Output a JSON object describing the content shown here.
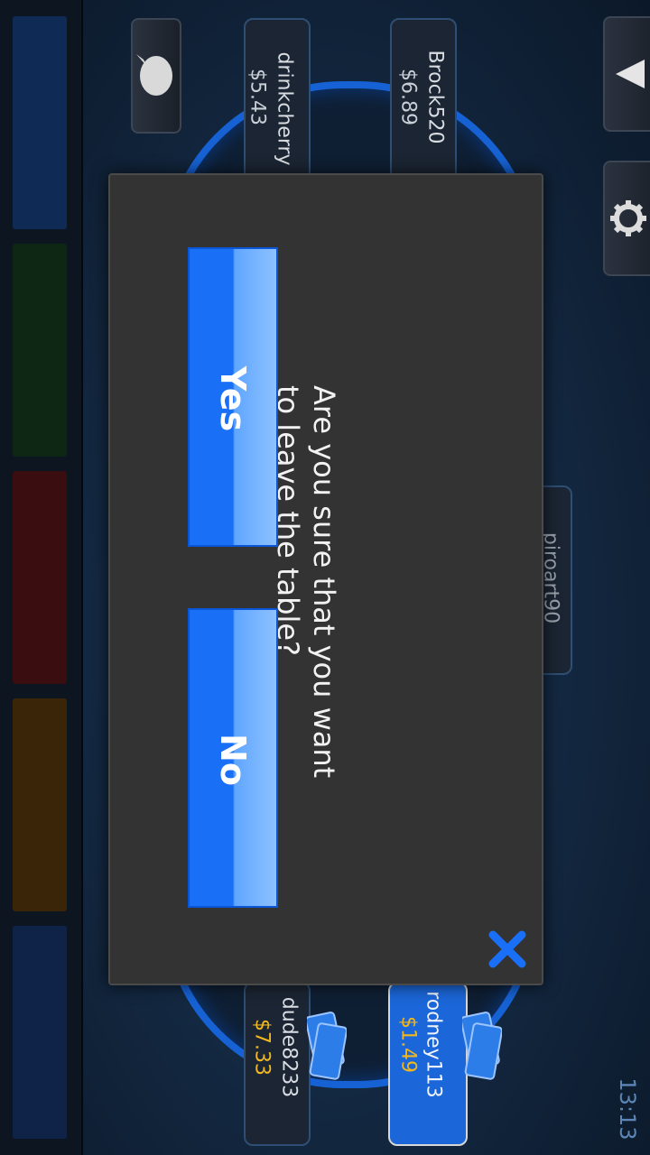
{
  "dialog": {
    "message_line1": "Are you sure that you want",
    "message_line2": "to leave the table?",
    "yes_label": "Yes",
    "no_label": "No",
    "close_icon": "close-x-icon"
  },
  "seats": [
    {
      "name": "Brock520",
      "stack": "$6.89"
    },
    {
      "name": "drinkcherry",
      "stack": "$5.43"
    },
    {
      "name": "piroart90",
      "stack": ""
    },
    {
      "name": "rodney113",
      "stack": "$1.49"
    },
    {
      "name": "dude8233",
      "stack": "$7.33"
    }
  ],
  "status": {
    "time": "13:13"
  },
  "icons": {
    "menu": "triangle-menu-icon",
    "settings": "gear-icon",
    "chat": "chat-bubble-icon"
  },
  "colors": {
    "accent_blue": "#1a6ff7",
    "stack_gold": "#f2b71f",
    "dialog_bg": "#333333"
  }
}
